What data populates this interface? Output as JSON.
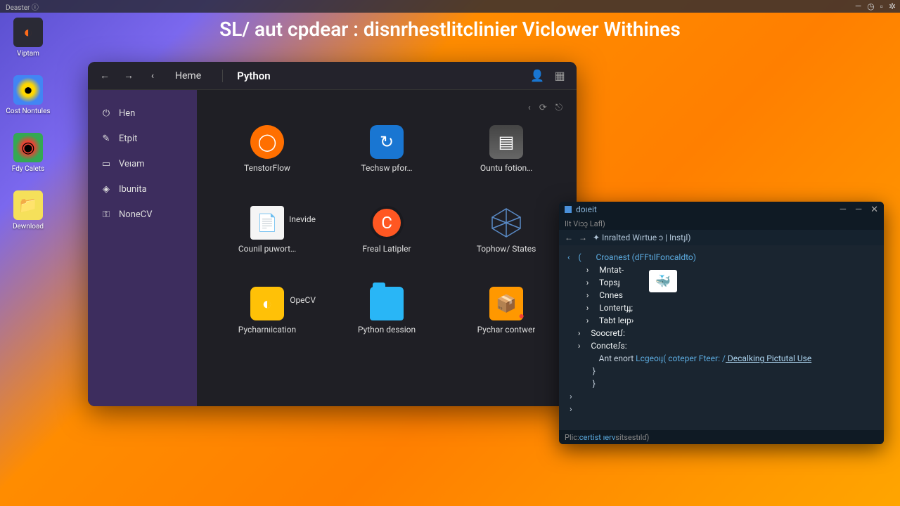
{
  "desktop": {
    "topbar_label": "Deaster  ⓘ",
    "icons": [
      {
        "label": "Viptam"
      },
      {
        "label": "Cost Nontules"
      },
      {
        "label": "Fdy Calets"
      },
      {
        "label": "Dewnload"
      }
    ]
  },
  "headline": "SL/ aut cpdear : disnrhestlitclinier Viclower Withines",
  "fileManager": {
    "nav": {
      "home": "Heme",
      "current": "Python"
    },
    "sidebar": [
      {
        "icon": "⏻",
        "label": "Hen"
      },
      {
        "icon": "✎",
        "label": "Etpit"
      },
      {
        "icon": "▭",
        "label": "Veıam"
      },
      {
        "icon": "◈",
        "label": "Ibunita"
      },
      {
        "icon": "⚿",
        "label": "NoneCV"
      }
    ],
    "items": [
      {
        "label": "TenstorFlow",
        "iconClass": "gi-tensorflow",
        "glyph": "◯"
      },
      {
        "label": "Techsw pfor…",
        "iconClass": "gi-tech",
        "glyph": "↻"
      },
      {
        "label": "Ountu fotion…",
        "iconClass": "gi-ountu",
        "glyph": "▤"
      },
      {
        "label": "Counil puwort…",
        "iconClass": "gi-doc",
        "glyph": "📄",
        "sub": "Inevide"
      },
      {
        "label": "Freal Latipler",
        "iconClass": "gi-freal",
        "glyph": "C"
      },
      {
        "label": "Tophow/ States",
        "iconClass": "gi-tophow",
        "glyph": ""
      },
      {
        "label": "Pycharnıication",
        "iconClass": "gi-opencv",
        "glyph": "◐",
        "sub": "OpeCV"
      },
      {
        "label": "Python dession",
        "iconClass": "gi-folder",
        "glyph": ""
      },
      {
        "label": "Pychar contwer",
        "iconClass": "gi-pychar",
        "glyph": "📦"
      }
    ]
  },
  "terminal": {
    "title": "doıeit",
    "menu": "IIt  Viɔɔ̨  Lafl)",
    "toolbar": "✦ Inralted Wırtue ɔ |  Instɟl)",
    "lines": {
      "l0": "‹    (       Croanest (dFFtılFoncaldto)",
      "l1": "         ›     Mntat-",
      "l2": "         ›     Topsɟ",
      "l3": "         ›     Cnnes",
      "l4": "         ›     Lontertɟɟ;",
      "l5": "         ›     Tabt leıp›",
      "l6": "",
      "l7": "     ›     Soocretꭍ:",
      "l8": "     ›     Concteꭍs:",
      "l9": "",
      "l10a": "               Ant enort ",
      "l10b": "Lcgeoıɟ( coteper Fteer: /",
      "l10c": " Decalking Pictutal Use",
      "l11": "            }",
      "l12": "            }",
      "l13": " ›",
      "l14": " ›"
    },
    "status_a": "Plic: ",
    "status_b": "certist ıerv",
    "status_c": " sitsestılɗ)"
  }
}
